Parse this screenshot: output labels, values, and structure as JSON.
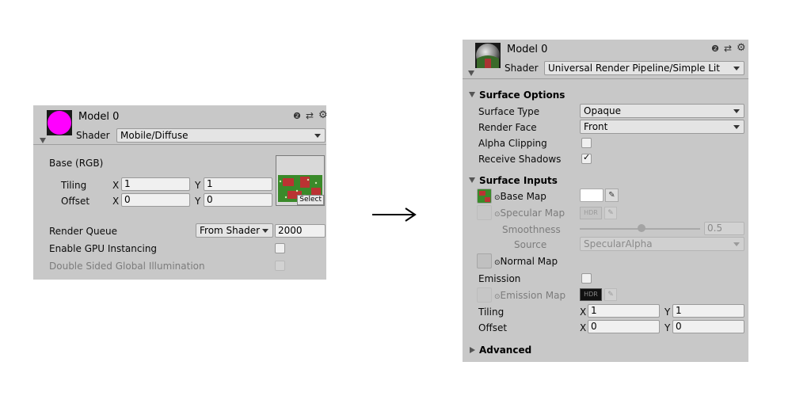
{
  "left": {
    "title": "Model 0",
    "shader_label": "Shader",
    "shader_value": "Mobile/Diffuse",
    "base_label": "Base (RGB)",
    "tiling_label": "Tiling",
    "offset_label": "Offset",
    "x_axis": "X",
    "y_axis": "Y",
    "tiling_x": "1",
    "tiling_y": "1",
    "offset_x": "0",
    "offset_y": "0",
    "select_label": "Select",
    "render_queue_label": "Render Queue",
    "render_queue_mode": "From Shader",
    "render_queue_value": "2000",
    "gpu_instancing_label": "Enable GPU Instancing",
    "double_sided_gi_label": "Double Sided Global Illumination",
    "preview_color": "#ff00ff"
  },
  "arrow": "⟶",
  "right": {
    "title": "Model 0",
    "shader_label": "Shader",
    "shader_value": "Universal Render Pipeline/Simple Lit",
    "surface_options": "Surface Options",
    "surface_type_label": "Surface Type",
    "surface_type_value": "Opaque",
    "render_face_label": "Render Face",
    "render_face_value": "Front",
    "alpha_clipping_label": "Alpha Clipping",
    "receive_shadows_label": "Receive Shadows",
    "check_glyph": "✓",
    "surface_inputs": "Surface Inputs",
    "base_map_label": "Base Map",
    "specular_map_label": "Specular Map",
    "hdr_label": "HDR",
    "smoothness_label": "Smoothness",
    "smoothness_value": "0.5",
    "source_label": "Source",
    "source_value": "SpecularAlpha",
    "normal_map_label": "Normal Map",
    "emission_label": "Emission",
    "emission_map_label": "Emission Map",
    "tiling_label": "Tiling",
    "offset_label": "Offset",
    "x_axis": "X",
    "y_axis": "Y",
    "tiling_x": "1",
    "tiling_y": "1",
    "offset_x": "0",
    "offset_y": "0",
    "advanced": "Advanced",
    "radio_glyph": "⊙"
  },
  "icons": {
    "help": "❷",
    "presets": "⇄",
    "settings": "⚙",
    "eyedropper": "✎"
  }
}
